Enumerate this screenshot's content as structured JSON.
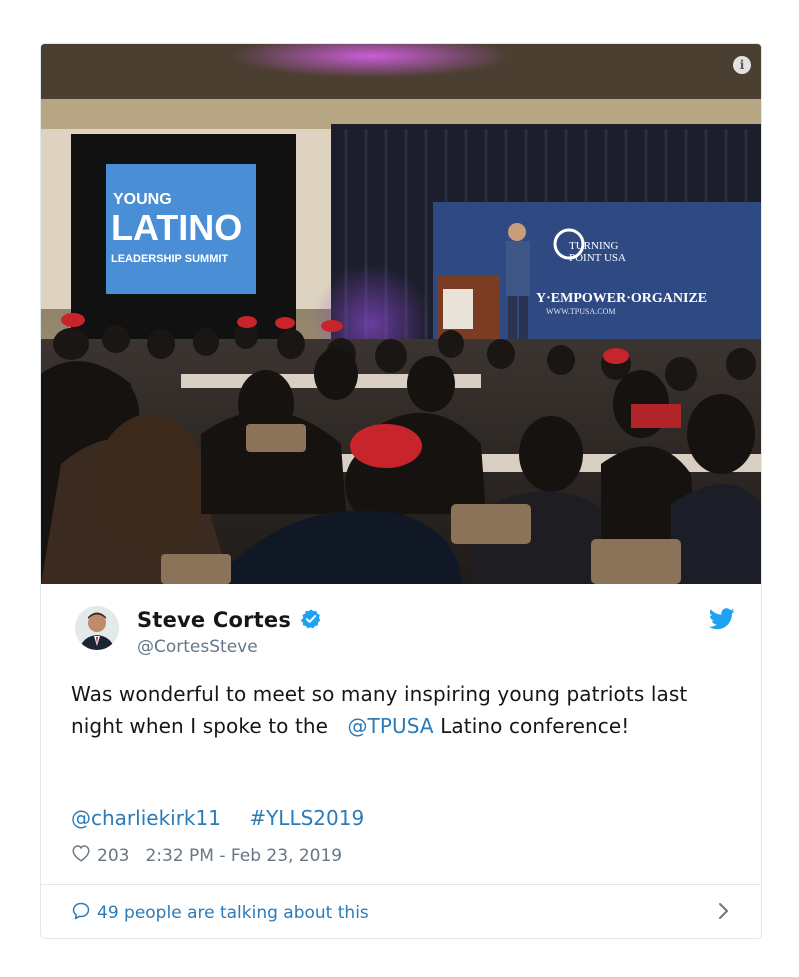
{
  "tweet": {
    "display_name": "Steve Cortes",
    "handle": "@CortesSteve",
    "verified": true,
    "text_before": "Was wonderful to meet so many inspiring young patriots last night when I spoke to the",
    "mention": "@TPUSA",
    "text_after": "Latino conference!",
    "tags": [
      "@charliekirk11",
      "#YLLS2019"
    ],
    "likes": "203",
    "timestamp": "2:32 PM - Feb 23, 2019",
    "talking": "49 people are talking about this"
  },
  "media": {
    "screen_line1": "YOUNG",
    "screen_line2": "LATINO",
    "screen_line3": "LEADERSHIP SUMMIT",
    "banner_brand1": "TURNING",
    "banner_brand2": "POINT USA",
    "banner_slogan": "Y·EMPOWER·ORGANIZE",
    "banner_url": "WWW.TPUSA.COM",
    "info_glyph": "i"
  },
  "colors": {
    "link": "#2b7bb9",
    "verified": "#1da1f2",
    "text": "#14171a",
    "muted": "#657786"
  },
  "icons": {
    "verified": "verified-badge-icon",
    "bird": "twitter-bird-icon",
    "heart": "heart-icon",
    "bubble": "reply-bubble-icon",
    "chevron": "chevron-right-icon",
    "info": "info-icon"
  }
}
